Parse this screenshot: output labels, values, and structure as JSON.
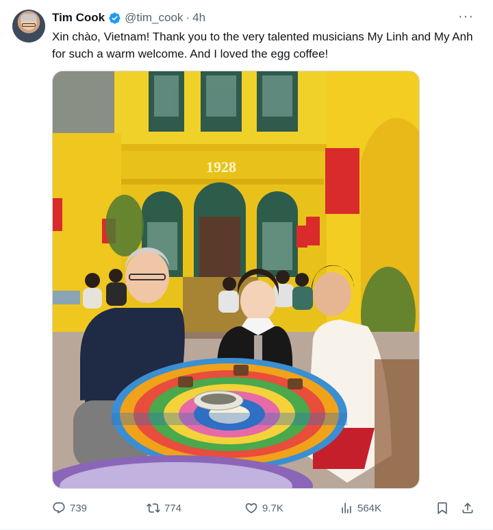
{
  "tweet": {
    "author_name": "Tim Cook",
    "handle": "@tim_cook",
    "separator": "·",
    "time": "4h",
    "more_label": "···",
    "text": "Xin chào, Vietnam! Thank you to the very talented musicians My Linh and My Anh for such a warm welcome. And I loved the egg coffee!",
    "photo_sign": "1928"
  },
  "actions": {
    "replies": "739",
    "retweets": "774",
    "likes": "9.7K",
    "views": "564K"
  },
  "colors": {
    "verified": "#1d9bf0",
    "icon_gray": "#536471",
    "text": "#0f1419"
  },
  "icons": [
    "verified-badge-icon",
    "more-icon",
    "reply-icon",
    "retweet-icon",
    "like-icon",
    "views-icon",
    "bookmark-icon",
    "share-icon"
  ]
}
